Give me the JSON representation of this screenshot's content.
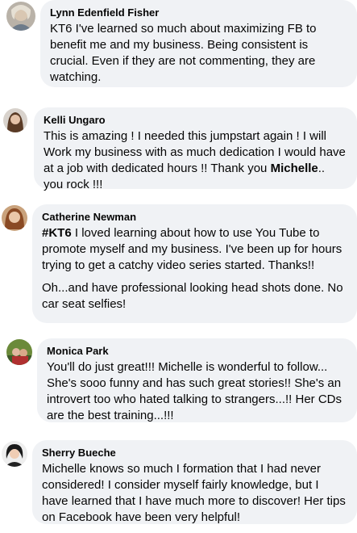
{
  "comments": [
    {
      "author": "Lynn Edenfield Fisher",
      "text": "KT6 I've learned so much about maximizing FB to benefit me and my business. Being consistent is crucial. Even if they are not commenting, they are watching."
    },
    {
      "author": "Kelli Ungaro",
      "text_before": "This is amazing ! I needed this jumpstart again ! I will Work my business with as much dedication I would have at a job with dedicated hours !! Thank you ",
      "mention": "Michelle",
      "text_after": ".. you rock !!!"
    },
    {
      "author": "Catherine Newman",
      "hashtag": "#KT6",
      "text_p1": " I loved learning about how to use You Tube to promote myself and my business. I've been up for hours trying to get a catchy video series started. Thanks!!",
      "text_p2": "Oh...and have professional looking head shots done. No car seat selfies!"
    },
    {
      "author": "Monica Park",
      "text": "You'll do just great!!! Michelle is wonderful to follow... She's sooo funny and has such great stories!! She's an introvert too who hated talking to strangers...!! Her CDs are the best training...!!!"
    },
    {
      "author": "Sherry Bueche",
      "text": "Michelle knows so much I formation that I had never considered! I consider myself fairly knowledge, but I have learned that I have much more to discover! Her tips on Facebook have been very helpful!"
    }
  ],
  "colors": {
    "bubble_bg": "#f0f2f5",
    "text": "#050505"
  }
}
